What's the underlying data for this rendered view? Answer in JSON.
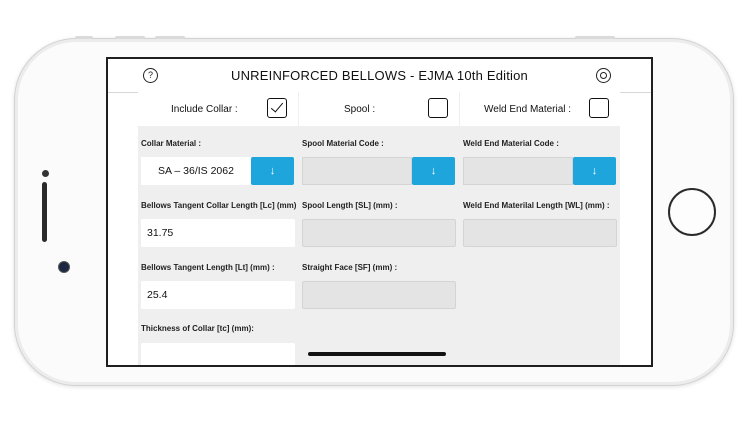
{
  "header": {
    "title": "UNREINFORCED BELLOWS - EJMA 10th Edition",
    "help_symbol": "?"
  },
  "columns": {
    "collar": {
      "toggle_label": "Include Collar :",
      "checked": true,
      "material_label": "Collar Material :",
      "material_value": "SA – 36/IS 2062",
      "dropdown_symbol": "↓",
      "tangent_collar_label": "Bellows Tangent Collar Length [Lc] (mm) :",
      "tangent_collar_value": "31.75",
      "tangent_length_label": "Bellows Tangent Length [Lt] (mm) :",
      "tangent_length_value": "25.4",
      "thickness_label": "Thickness of Collar [tc] (mm):"
    },
    "spool": {
      "toggle_label": "Spool :",
      "checked": false,
      "material_label": "Spool Material Code :",
      "dropdown_symbol": "↓",
      "length_label": "Spool Length [SL] (mm) :",
      "straight_face_label": "Straight Face [SF] (mm) :"
    },
    "weld": {
      "toggle_label": "Weld End Material :",
      "checked": false,
      "material_label": "Weld End Material Code :",
      "dropdown_symbol": "↓",
      "length_label": "Weld End Materilal Length [WL] (mm) :"
    }
  },
  "colors": {
    "accent": "#1ea6dc",
    "panel": "#efefef",
    "disabled_field": "#e4e4e4"
  }
}
